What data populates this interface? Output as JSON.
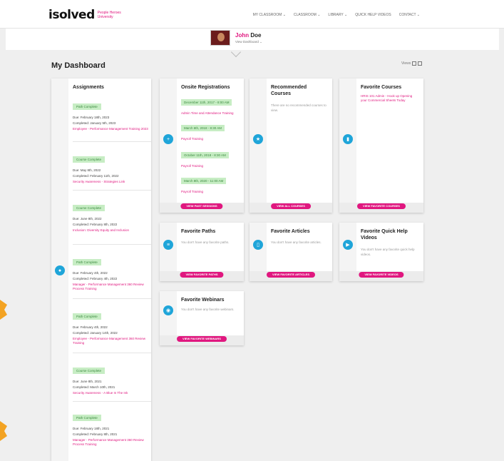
{
  "header": {
    "logo": "isolved",
    "logo_sub": "People Heroes University",
    "nav": [
      "MY CLASSROOM ⌄",
      "CLASSROOM ⌄",
      "LIBRARY ⌄",
      "QUICK HELP VIDEOS",
      "CONTACT ⌄"
    ]
  },
  "profile": {
    "name_first": "John",
    "name_last": "Doe",
    "link": "View Dashboard ⌄"
  },
  "dashboard": {
    "title": "My Dashboard",
    "view_label": "Views"
  },
  "assignments": {
    "title": "Assignments",
    "items": [
      {
        "badge": "Path Complete",
        "due": "Due: February 18th, 2023",
        "completed": "Completed: January 5th, 2023",
        "course": "Employee - Performance Management Training 2023"
      },
      {
        "badge": "Course Complete",
        "due": "Due: May 8th, 2022",
        "completed": "Completed: February 11th, 2022",
        "course": "Security Awareness - Strategies Link"
      },
      {
        "badge": "Course Complete",
        "due": "Due: June 8th, 2022",
        "completed": "Completed: February 8th, 2022",
        "course": "Inclusion: Diversity Equity and Inclusion"
      },
      {
        "badge": "Path Complete",
        "due": "Due: February 4th, 2022",
        "completed": "Completed: February 4th, 2022",
        "course": "Manager - Performance Management 360 Review Process Training"
      },
      {
        "badge": "Path Complete",
        "due": "Due: February 4th, 2022",
        "completed": "Completed: January 14th, 2022",
        "course": "Employee - Performance Management 360 Review Training"
      },
      {
        "badge": "Course Complete",
        "due": "Due: June 8th, 2021",
        "completed": "Completed: March 10th, 2021",
        "course": "Security Awareness - A Blue In The Ink"
      },
      {
        "badge": "Path Complete",
        "due": "Due: February 18th, 2021",
        "completed": "Completed: February 8th, 2021",
        "course": "Manager - Performance Management 360 Review Process Training"
      }
    ]
  },
  "onsite": {
    "title": "Onsite Registrations",
    "items": [
      {
        "date": "December 11th, 2017 - 8:00 AM",
        "name": "Admin Time and Attendance Training"
      },
      {
        "date": "March 6th, 2018 - 8:30 AM",
        "name": "Payroll Training"
      },
      {
        "date": "October 11th, 2018 - 8:30 AM",
        "name": "Payroll Training"
      },
      {
        "date": "March 8th, 2020 - 11:00 AM",
        "name": "Payroll Training"
      }
    ],
    "button": "VIEW PAST SESSIONS"
  },
  "recommended": {
    "title": "Recommended Courses",
    "empty": "There are no recommended courses to view.",
    "button": "VIEW ALL COURSES"
  },
  "fav_courses": {
    "title": "Favorite Courses",
    "course": "HRIS 101 Admin - Hook up Opening your Commercial Sheets Today",
    "button": "VIEW FAVORITE COURSES"
  },
  "fav_paths": {
    "title": "Favorite Paths",
    "empty": "You don't have any favorite paths.",
    "button": "VIEW FAVORITE PATHS"
  },
  "fav_articles": {
    "title": "Favorite Articles",
    "empty": "You don't have any favorite articles.",
    "button": "VIEW FAVORITE ARTICLES"
  },
  "fav_videos": {
    "title": "Favorite Quick Help Videos",
    "empty": "You don't have any favorite quick help videos.",
    "button": "VIEW FAVORITE VIDEOS"
  },
  "fav_webinars": {
    "title": "Favorite Webinars",
    "empty": "You don't have any favorite webinars.",
    "button": "VIEW FAVORITE WEBINARS"
  },
  "colors": {
    "accent": "#e0177f",
    "icon_blue": "#1fa5d9",
    "badge_green": "#c7edc4"
  }
}
